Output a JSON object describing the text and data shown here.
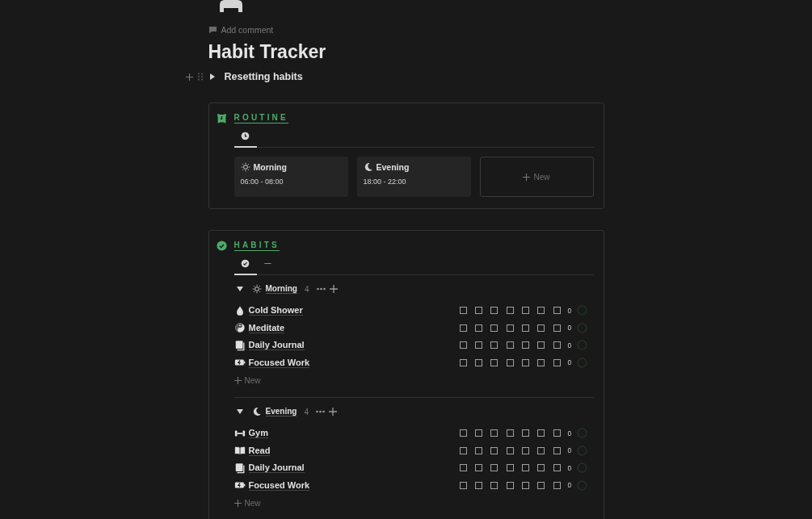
{
  "page": {
    "add_comment": "Add comment",
    "title": "Habit Tracker",
    "toggle": {
      "label": "Resetting habits",
      "expanded": false
    }
  },
  "routine": {
    "title": "ROUTINE",
    "tabs": [
      {
        "kind": "clock",
        "selected": true
      }
    ],
    "cards": [
      {
        "kind": "sun",
        "name": "Morning",
        "time": "06:00 - 08:00"
      },
      {
        "kind": "moon",
        "name": "Evening",
        "time": "18:00 - 22:00"
      }
    ],
    "new_label": "New"
  },
  "habits": {
    "title": "HABITS",
    "tabs": [
      {
        "kind": "check",
        "selected": true
      },
      {
        "kind": "dash",
        "selected": false
      }
    ],
    "groups": [
      {
        "kind": "sun",
        "name": "Morning",
        "count": "4",
        "expanded": true,
        "new_label": "New",
        "items": [
          {
            "kind": "drop",
            "name": "Cold Shower",
            "days": [
              false,
              false,
              false,
              false,
              false,
              false,
              false
            ],
            "total": "0",
            "level": 0
          },
          {
            "kind": "yinyang",
            "name": "Meditate",
            "days": [
              false,
              false,
              false,
              false,
              false,
              false,
              false
            ],
            "total": "0",
            "level": 0
          },
          {
            "kind": "notebook",
            "name": "Daily Journal",
            "days": [
              false,
              false,
              false,
              false,
              false,
              false,
              false
            ],
            "total": "0",
            "level": 0
          },
          {
            "kind": "battery",
            "name": "Focused Work",
            "days": [
              false,
              false,
              false,
              false,
              false,
              false,
              false
            ],
            "total": "0",
            "level": 0
          }
        ]
      },
      {
        "kind": "moon",
        "name": "Evening",
        "count": "4",
        "expanded": true,
        "new_label": "New",
        "items": [
          {
            "kind": "dumbbell",
            "name": "Gym",
            "days": [
              false,
              false,
              false,
              false,
              false,
              false,
              false
            ],
            "total": "0",
            "level": 0
          },
          {
            "kind": "book",
            "name": "Read",
            "days": [
              false,
              false,
              false,
              false,
              false,
              false,
              false
            ],
            "total": "0",
            "level": 0
          },
          {
            "kind": "notebook",
            "name": "Daily Journal",
            "days": [
              false,
              false,
              false,
              false,
              false,
              false,
              false
            ],
            "total": "0",
            "level": 0
          },
          {
            "kind": "battery",
            "name": "Focused Work",
            "days": [
              false,
              false,
              false,
              false,
              false,
              false,
              false
            ],
            "total": "0",
            "level": 0
          }
        ]
      }
    ]
  }
}
